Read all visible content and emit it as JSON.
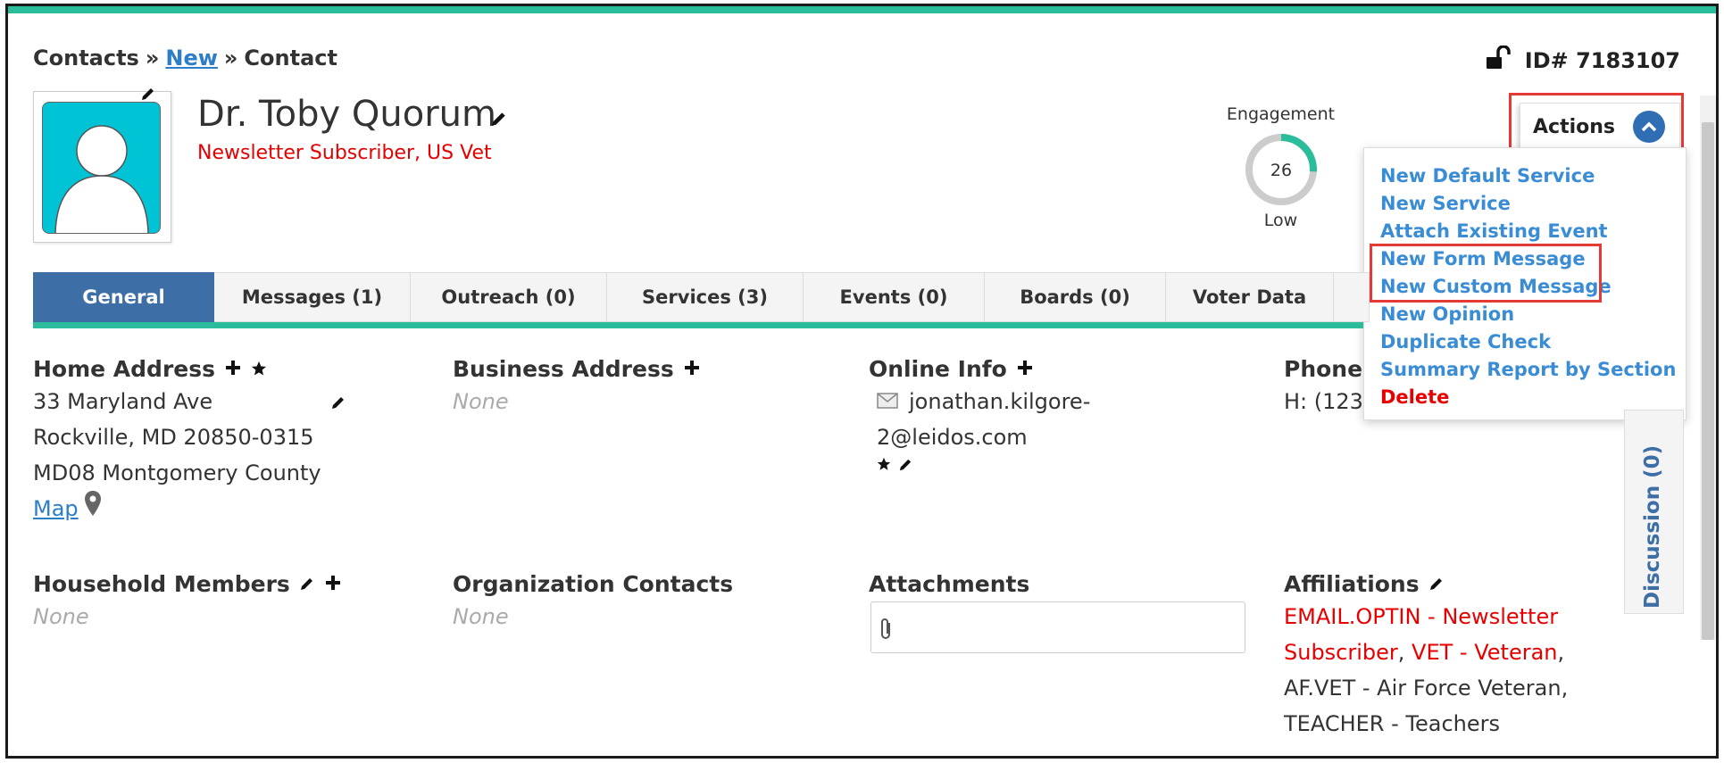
{
  "breadcrumb": {
    "root": "Contacts",
    "sep": "»",
    "middle": "New",
    "current": "Contact"
  },
  "record_id": "ID# 7183107",
  "contact": {
    "name": "Dr. Toby Quorum",
    "subtitle": "Newsletter Subscriber, US Vet"
  },
  "engagement": {
    "label": "Engagement",
    "score": "26",
    "level": "Low",
    "fraction": 0.26,
    "color": "#2bbc9b"
  },
  "actions": {
    "label": "Actions",
    "menu": [
      "New Default Service",
      "New Service",
      "Attach Existing Event",
      "New Form Message",
      "New Custom Message",
      "New Opinion",
      "Duplicate Check",
      "Summary Report by Section",
      "Delete"
    ]
  },
  "tabs": [
    "General",
    "Messages (1)",
    "Outreach (0)",
    "Services (3)",
    "Events (0)",
    "Boards (0)",
    "Voter Data"
  ],
  "home_address": {
    "title": "Home Address",
    "lines": [
      "33 Maryland Ave",
      "Rockville, MD 20850-0315",
      "MD08 Montgomery County"
    ],
    "map_link": "Map"
  },
  "business_address": {
    "title": "Business Address",
    "value": "None"
  },
  "online_info": {
    "title": "Online Info",
    "email_line1": "jonathan.kilgore-",
    "email_line2": "2@leidos.com"
  },
  "phone": {
    "title": "Phone",
    "value": "H: (123"
  },
  "household": {
    "title": "Household Members",
    "value": "None"
  },
  "org_contacts": {
    "title": "Organization Contacts",
    "value": "None"
  },
  "attachments": {
    "title": "Attachments"
  },
  "affiliations": {
    "title": "Affiliations",
    "line1": "EMAIL.OPTIN - Newsletter",
    "line2_red1": "Subscriber",
    "line2_sep": ", ",
    "line2_red2": "VET - Veteran",
    "line2_tail": ",",
    "line3": "AF.VET - Air Force Veteran,",
    "line4": "TEACHER - Teachers"
  },
  "discussion": {
    "label": "Discussion (0)"
  },
  "colors": {
    "accent": "#2bbc9b",
    "tab_active": "#3e6ea6",
    "link": "#2b7ec7",
    "menu_link": "#3a8cd4",
    "alert": "#e60000"
  }
}
